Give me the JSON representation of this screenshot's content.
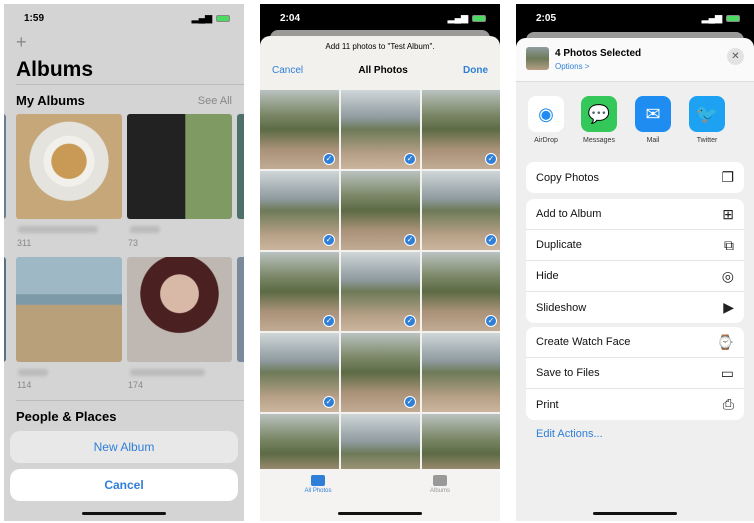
{
  "screen1": {
    "time": "1:59",
    "add_icon": "plus-icon",
    "title": "Albums",
    "section1": "My Albums",
    "see_all": "See All",
    "albums": [
      {
        "count": "311"
      },
      {
        "count": "73"
      },
      {
        "count": "114"
      },
      {
        "count": "174"
      }
    ],
    "section2": "People & Places",
    "new_album": "New Album",
    "cancel": "Cancel"
  },
  "screen2": {
    "time": "2:04",
    "prompt": "Add 11 photos to \"Test Album\".",
    "cancel": "Cancel",
    "title": "All Photos",
    "done": "Done",
    "selected": [
      1,
      1,
      1,
      1,
      1,
      1,
      1,
      1,
      1,
      1,
      1,
      0,
      0,
      0,
      0
    ],
    "tabs": [
      {
        "label": "All Photos",
        "icon": "photos-icon",
        "active": true
      },
      {
        "label": "Albums",
        "icon": "albums-icon",
        "active": false
      }
    ]
  },
  "screen3": {
    "time": "2:05",
    "header_title": "4 Photos Selected",
    "options": "Options >",
    "apps": [
      {
        "label": "AirDrop",
        "color": "#ffffff"
      },
      {
        "label": "Messages",
        "color": "#34c759"
      },
      {
        "label": "Mail",
        "color": "#1e8cf0"
      },
      {
        "label": "Twitter",
        "color": "#1da1f2"
      }
    ],
    "group1": [
      {
        "label": "Copy Photos",
        "icon": "copy-icon"
      }
    ],
    "group2": [
      {
        "label": "Add to Album",
        "icon": "add-album-icon"
      },
      {
        "label": "Duplicate",
        "icon": "duplicate-icon"
      },
      {
        "label": "Hide",
        "icon": "hide-icon"
      },
      {
        "label": "Slideshow",
        "icon": "play-icon"
      }
    ],
    "group3": [
      {
        "label": "Create Watch Face",
        "icon": "watch-icon"
      },
      {
        "label": "Save to Files",
        "icon": "folder-icon"
      },
      {
        "label": "Print",
        "icon": "printer-icon"
      }
    ],
    "edit_actions": "Edit Actions..."
  },
  "colors": {
    "accent": "#2f7fd8"
  }
}
